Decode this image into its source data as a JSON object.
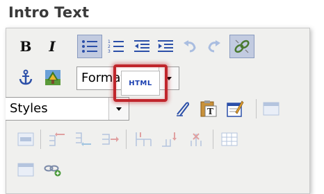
{
  "title": "Intro Text",
  "toolbar": {
    "bold_label": "B",
    "italic_label": "I",
    "format_select": {
      "value": "Format"
    },
    "styles_select": {
      "value": "Styles"
    },
    "html_label": "HTML"
  },
  "colors": {
    "highlight": "#c0262c",
    "active_button_bg": "#c2cbe0",
    "html_text": "#1a3fb0"
  }
}
